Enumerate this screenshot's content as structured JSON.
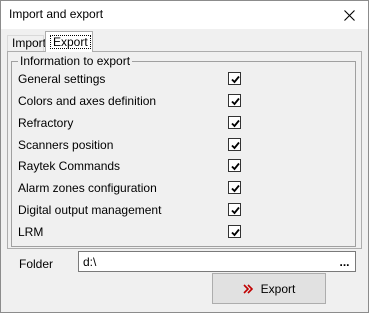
{
  "window": {
    "title": "Import and export"
  },
  "tabs": [
    {
      "label": "Import",
      "active": false
    },
    {
      "label": "Export",
      "active": true
    }
  ],
  "group": {
    "caption": "Information to export",
    "items": [
      {
        "label": "General settings",
        "checked": true
      },
      {
        "label": "Colors and axes definition",
        "checked": true
      },
      {
        "label": "Refractory",
        "checked": true
      },
      {
        "label": "Scanners position",
        "checked": true
      },
      {
        "label": "Raytek Commands",
        "checked": true
      },
      {
        "label": "Alarm zones configuration",
        "checked": true
      },
      {
        "label": "Digital output management",
        "checked": true
      },
      {
        "label": "LRM",
        "checked": true
      }
    ]
  },
  "folder": {
    "label": "Folder",
    "value": "d:\\",
    "browse_label": "..."
  },
  "export_button": {
    "label": "Export",
    "icon": "double-chevron-right-icon",
    "icon_color": "#c00000"
  }
}
